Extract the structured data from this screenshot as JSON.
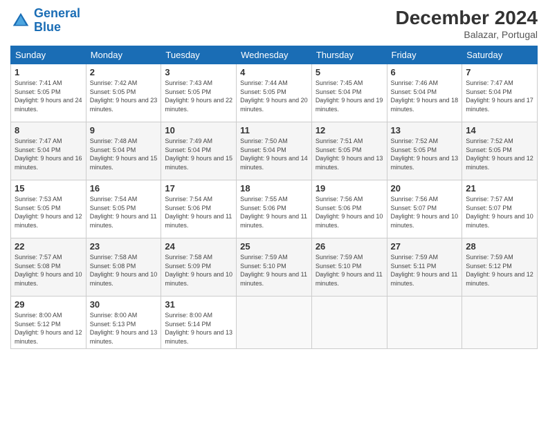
{
  "header": {
    "logo_line1": "General",
    "logo_line2": "Blue",
    "month": "December 2024",
    "location": "Balazar, Portugal"
  },
  "weekdays": [
    "Sunday",
    "Monday",
    "Tuesday",
    "Wednesday",
    "Thursday",
    "Friday",
    "Saturday"
  ],
  "weeks": [
    [
      {
        "day": "1",
        "sunrise": "Sunrise: 7:41 AM",
        "sunset": "Sunset: 5:05 PM",
        "daylight": "Daylight: 9 hours and 24 minutes."
      },
      {
        "day": "2",
        "sunrise": "Sunrise: 7:42 AM",
        "sunset": "Sunset: 5:05 PM",
        "daylight": "Daylight: 9 hours and 23 minutes."
      },
      {
        "day": "3",
        "sunrise": "Sunrise: 7:43 AM",
        "sunset": "Sunset: 5:05 PM",
        "daylight": "Daylight: 9 hours and 22 minutes."
      },
      {
        "day": "4",
        "sunrise": "Sunrise: 7:44 AM",
        "sunset": "Sunset: 5:05 PM",
        "daylight": "Daylight: 9 hours and 20 minutes."
      },
      {
        "day": "5",
        "sunrise": "Sunrise: 7:45 AM",
        "sunset": "Sunset: 5:04 PM",
        "daylight": "Daylight: 9 hours and 19 minutes."
      },
      {
        "day": "6",
        "sunrise": "Sunrise: 7:46 AM",
        "sunset": "Sunset: 5:04 PM",
        "daylight": "Daylight: 9 hours and 18 minutes."
      },
      {
        "day": "7",
        "sunrise": "Sunrise: 7:47 AM",
        "sunset": "Sunset: 5:04 PM",
        "daylight": "Daylight: 9 hours and 17 minutes."
      }
    ],
    [
      {
        "day": "8",
        "sunrise": "Sunrise: 7:47 AM",
        "sunset": "Sunset: 5:04 PM",
        "daylight": "Daylight: 9 hours and 16 minutes."
      },
      {
        "day": "9",
        "sunrise": "Sunrise: 7:48 AM",
        "sunset": "Sunset: 5:04 PM",
        "daylight": "Daylight: 9 hours and 15 minutes."
      },
      {
        "day": "10",
        "sunrise": "Sunrise: 7:49 AM",
        "sunset": "Sunset: 5:04 PM",
        "daylight": "Daylight: 9 hours and 15 minutes."
      },
      {
        "day": "11",
        "sunrise": "Sunrise: 7:50 AM",
        "sunset": "Sunset: 5:04 PM",
        "daylight": "Daylight: 9 hours and 14 minutes."
      },
      {
        "day": "12",
        "sunrise": "Sunrise: 7:51 AM",
        "sunset": "Sunset: 5:05 PM",
        "daylight": "Daylight: 9 hours and 13 minutes."
      },
      {
        "day": "13",
        "sunrise": "Sunrise: 7:52 AM",
        "sunset": "Sunset: 5:05 PM",
        "daylight": "Daylight: 9 hours and 13 minutes."
      },
      {
        "day": "14",
        "sunrise": "Sunrise: 7:52 AM",
        "sunset": "Sunset: 5:05 PM",
        "daylight": "Daylight: 9 hours and 12 minutes."
      }
    ],
    [
      {
        "day": "15",
        "sunrise": "Sunrise: 7:53 AM",
        "sunset": "Sunset: 5:05 PM",
        "daylight": "Daylight: 9 hours and 12 minutes."
      },
      {
        "day": "16",
        "sunrise": "Sunrise: 7:54 AM",
        "sunset": "Sunset: 5:05 PM",
        "daylight": "Daylight: 9 hours and 11 minutes."
      },
      {
        "day": "17",
        "sunrise": "Sunrise: 7:54 AM",
        "sunset": "Sunset: 5:06 PM",
        "daylight": "Daylight: 9 hours and 11 minutes."
      },
      {
        "day": "18",
        "sunrise": "Sunrise: 7:55 AM",
        "sunset": "Sunset: 5:06 PM",
        "daylight": "Daylight: 9 hours and 11 minutes."
      },
      {
        "day": "19",
        "sunrise": "Sunrise: 7:56 AM",
        "sunset": "Sunset: 5:06 PM",
        "daylight": "Daylight: 9 hours and 10 minutes."
      },
      {
        "day": "20",
        "sunrise": "Sunrise: 7:56 AM",
        "sunset": "Sunset: 5:07 PM",
        "daylight": "Daylight: 9 hours and 10 minutes."
      },
      {
        "day": "21",
        "sunrise": "Sunrise: 7:57 AM",
        "sunset": "Sunset: 5:07 PM",
        "daylight": "Daylight: 9 hours and 10 minutes."
      }
    ],
    [
      {
        "day": "22",
        "sunrise": "Sunrise: 7:57 AM",
        "sunset": "Sunset: 5:08 PM",
        "daylight": "Daylight: 9 hours and 10 minutes."
      },
      {
        "day": "23",
        "sunrise": "Sunrise: 7:58 AM",
        "sunset": "Sunset: 5:08 PM",
        "daylight": "Daylight: 9 hours and 10 minutes."
      },
      {
        "day": "24",
        "sunrise": "Sunrise: 7:58 AM",
        "sunset": "Sunset: 5:09 PM",
        "daylight": "Daylight: 9 hours and 10 minutes."
      },
      {
        "day": "25",
        "sunrise": "Sunrise: 7:59 AM",
        "sunset": "Sunset: 5:10 PM",
        "daylight": "Daylight: 9 hours and 11 minutes."
      },
      {
        "day": "26",
        "sunrise": "Sunrise: 7:59 AM",
        "sunset": "Sunset: 5:10 PM",
        "daylight": "Daylight: 9 hours and 11 minutes."
      },
      {
        "day": "27",
        "sunrise": "Sunrise: 7:59 AM",
        "sunset": "Sunset: 5:11 PM",
        "daylight": "Daylight: 9 hours and 11 minutes."
      },
      {
        "day": "28",
        "sunrise": "Sunrise: 7:59 AM",
        "sunset": "Sunset: 5:12 PM",
        "daylight": "Daylight: 9 hours and 12 minutes."
      }
    ],
    [
      {
        "day": "29",
        "sunrise": "Sunrise: 8:00 AM",
        "sunset": "Sunset: 5:12 PM",
        "daylight": "Daylight: 9 hours and 12 minutes."
      },
      {
        "day": "30",
        "sunrise": "Sunrise: 8:00 AM",
        "sunset": "Sunset: 5:13 PM",
        "daylight": "Daylight: 9 hours and 13 minutes."
      },
      {
        "day": "31",
        "sunrise": "Sunrise: 8:00 AM",
        "sunset": "Sunset: 5:14 PM",
        "daylight": "Daylight: 9 hours and 13 minutes."
      },
      null,
      null,
      null,
      null
    ]
  ]
}
